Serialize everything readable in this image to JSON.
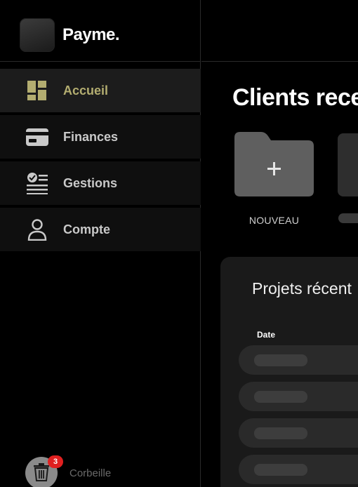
{
  "brand": {
    "name": "Payme."
  },
  "sidebar": {
    "items": [
      {
        "label": "Accueil",
        "icon": "dashboard-icon",
        "active": true
      },
      {
        "label": "Finances",
        "icon": "credit-card-icon",
        "active": false
      },
      {
        "label": "Gestions",
        "icon": "checklist-icon",
        "active": false
      },
      {
        "label": "Compte",
        "icon": "user-icon",
        "active": false
      }
    ],
    "trash": {
      "label": "Corbeille",
      "badge": "3",
      "icon": "trash-icon"
    }
  },
  "main": {
    "title": "Clients rece",
    "new_folder": {
      "label": "NOUVEAU",
      "icon": "plus-icon"
    },
    "projects": {
      "title": "Projets récent",
      "columns": [
        "Date"
      ]
    }
  },
  "colors": {
    "accent": "#b3ad70",
    "badge": "#e02020",
    "folder": "#5f5f5f"
  }
}
